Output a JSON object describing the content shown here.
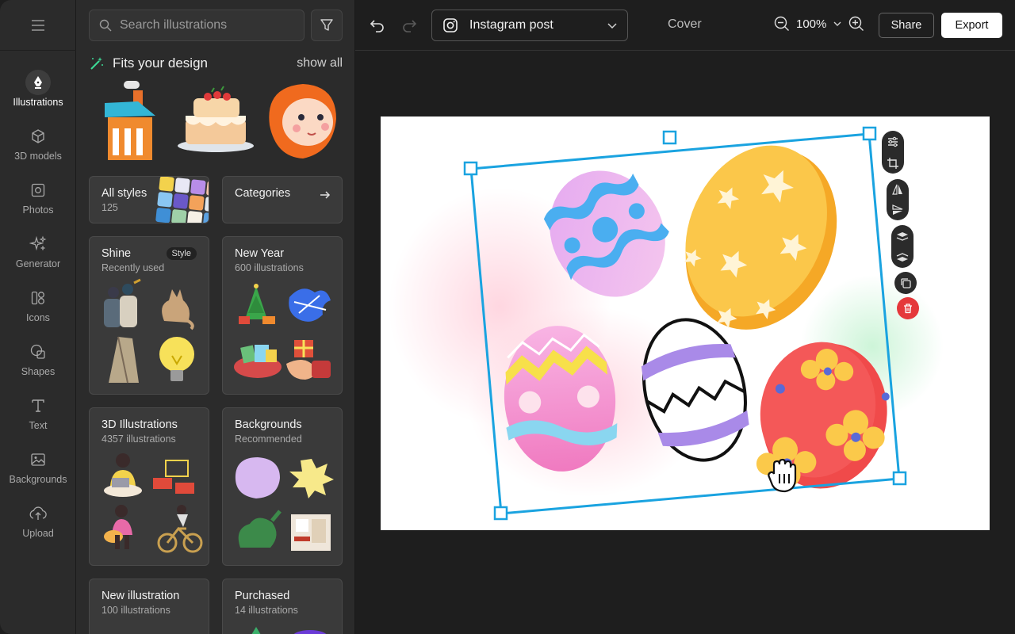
{
  "rail": {
    "items": [
      {
        "label": "Illustrations",
        "icon": "pen-nib-icon",
        "active": true
      },
      {
        "label": "3D models",
        "icon": "cube-icon",
        "active": false
      },
      {
        "label": "Photos",
        "icon": "photo-icon",
        "active": false
      },
      {
        "label": "Generator",
        "icon": "sparkles-icon",
        "active": false
      },
      {
        "label": "Icons",
        "icon": "icons-icon",
        "active": false
      },
      {
        "label": "Shapes",
        "icon": "shapes-icon",
        "active": false
      },
      {
        "label": "Text",
        "icon": "text-icon",
        "active": false
      },
      {
        "label": "Backgrounds",
        "icon": "image-icon",
        "active": false
      },
      {
        "label": "Upload",
        "icon": "upload-cloud-icon",
        "active": false
      }
    ]
  },
  "panel": {
    "search_placeholder": "Search illustrations",
    "fits_title": "Fits your design",
    "show_all": "show all",
    "all_styles": {
      "title": "All styles",
      "count": "125"
    },
    "categories": {
      "title": "Categories"
    },
    "cards": [
      {
        "title": "Shine",
        "subtitle": "Recently used",
        "badge": "Style"
      },
      {
        "title": "New Year",
        "subtitle": "600 illustrations"
      },
      {
        "title": "3D Illustrations",
        "subtitle": "4357 illustrations"
      },
      {
        "title": "Backgrounds",
        "subtitle": "Recommended"
      },
      {
        "title": "New illustration",
        "subtitle": "100 illustrations"
      },
      {
        "title": "Purchased",
        "subtitle": "14 illustrations"
      }
    ]
  },
  "topbar": {
    "format": "Instagram post",
    "cover": "Cover",
    "zoom": "100%",
    "share": "Share",
    "export": "Export"
  },
  "colors": {
    "selection": "#1aa3e0",
    "delete": "#e5383b",
    "accent_export": "#ffffff"
  }
}
